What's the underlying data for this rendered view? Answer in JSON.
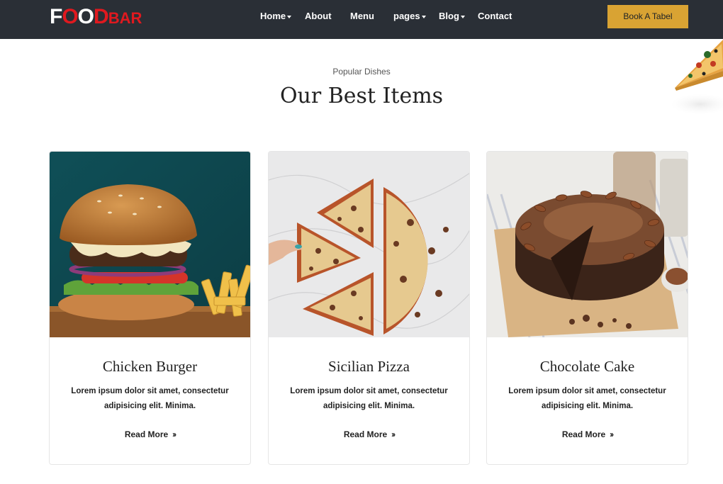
{
  "brand": {
    "logo_text": "FOODBAR",
    "logo_part1": "F",
    "logo_o1": "O",
    "logo_o2": "O",
    "logo_d": "D",
    "logo_small": "BAR"
  },
  "nav": {
    "items": [
      {
        "label": "Home",
        "has_dropdown": true
      },
      {
        "label": "About",
        "has_dropdown": false
      },
      {
        "label": "Menu",
        "has_dropdown": false
      },
      {
        "label": "pages",
        "has_dropdown": true
      },
      {
        "label": "Blog",
        "has_dropdown": true
      },
      {
        "label": "Contact",
        "has_dropdown": false
      }
    ],
    "cta_label": "Book A Tabel"
  },
  "section": {
    "subtitle": "Popular Dishes",
    "title": "Our Best Items"
  },
  "cards": [
    {
      "title": "Chicken Burger",
      "desc_line1": "Lorem ipsum dolor sit amet, consectetur",
      "desc_line2": "adipisicing elit. Minima.",
      "more": "Read More",
      "image": "burger-image"
    },
    {
      "title": "Sicilian Pizza",
      "desc_line1": "Lorem ipsum dolor sit amet, consectetur",
      "desc_line2": "adipisicing elit. Minima.",
      "more": "Read More",
      "image": "pizza-image"
    },
    {
      "title": "Chocolate Cake",
      "desc_line1": "Lorem ipsum dolor sit amet, consectetur",
      "desc_line2": "adipisicing elit. Minima.",
      "more": "Read More",
      "image": "cake-image"
    }
  ],
  "colors": {
    "navbar": "#2a2f36",
    "accent": "#d9a333",
    "logo_red": "#e0191f"
  },
  "icons": {
    "read_more": "double-chevron-right-icon",
    "dropdown": "caret-down-icon"
  }
}
